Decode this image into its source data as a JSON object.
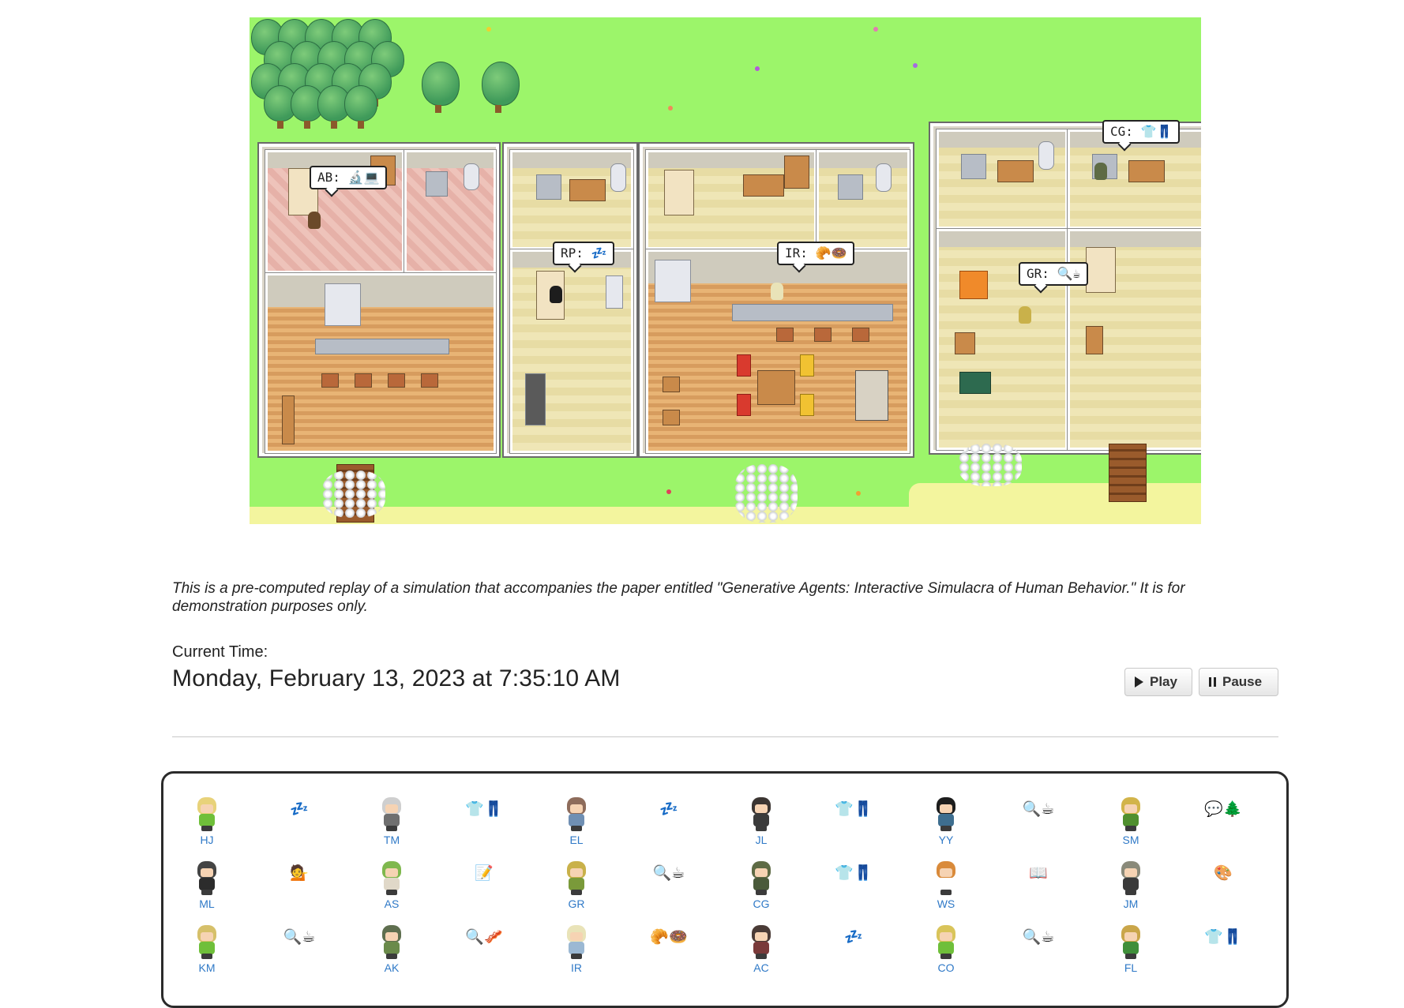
{
  "map": {
    "bubbles": [
      {
        "id": "AB",
        "text": "AB: 🔬💻"
      },
      {
        "id": "RP",
        "text": "RP: 💤"
      },
      {
        "id": "IR",
        "text": "IR: 🥐🍩"
      },
      {
        "id": "CG",
        "text": "CG: 👕👖"
      },
      {
        "id": "GR",
        "text": "GR: 🔍☕"
      }
    ]
  },
  "caption": "This is a pre-computed replay of a simulation that accompanies the paper entitled \"Generative Agents: Interactive Simulacra of Human Behavior.\" It is for demonstration purposes only.",
  "time": {
    "label": "Current Time:",
    "value": "Monday, February 13, 2023 at 7:35:10 AM"
  },
  "controls": {
    "play_label": "Play",
    "pause_label": "Pause"
  },
  "agents": {
    "rows": [
      [
        {
          "initials": "HJ",
          "hair": "#e8d27a",
          "shirt": "#6fbf3a",
          "emoji": "💤"
        },
        {
          "initials": "TM",
          "hair": "#cfcfcf",
          "shirt": "#6f6f6f",
          "emoji": "👕👖"
        },
        {
          "initials": "EL",
          "hair": "#8e6c5b",
          "shirt": "#6f8fb3",
          "emoji": "💤"
        },
        {
          "initials": "JL",
          "hair": "#3b3532",
          "shirt": "#3b3b3b",
          "emoji": "👕👖"
        },
        {
          "initials": "YY",
          "hair": "#1d1d1d",
          "shirt": "#3e6e8f",
          "emoji": "🔍☕"
        },
        {
          "initials": "SM",
          "hair": "#d2b44a",
          "shirt": "#4f8f2e",
          "emoji": "💬🌲"
        }
      ],
      [
        {
          "initials": "ML",
          "hair": "#444444",
          "shirt": "#2c2c2c",
          "emoji": "💁"
        },
        {
          "initials": "AS",
          "hair": "#7fb84e",
          "shirt": "#e0d8c8",
          "emoji": "📝"
        },
        {
          "initials": "GR",
          "hair": "#c9b14a",
          "shirt": "#7a9a3a",
          "emoji": "🔍☕"
        },
        {
          "initials": "CG",
          "hair": "#5e6b45",
          "shirt": "#4a5a3a",
          "emoji": "👕👖"
        },
        {
          "initials": "WS",
          "hair": "#d98a3a",
          "shirt": "#ffffff",
          "emoji": "📖"
        },
        {
          "initials": "JM",
          "hair": "#8a8a7a",
          "shirt": "#3a3a3a",
          "emoji": "🎨"
        }
      ],
      [
        {
          "initials": "KM",
          "hair": "#d6c06a",
          "shirt": "#6fbf3a",
          "emoji": "🔍☕"
        },
        {
          "initials": "AK",
          "hair": "#5f6f4f",
          "shirt": "#6a8a4a",
          "emoji": "🔍🥓"
        },
        {
          "initials": "IR",
          "hair": "#e9e3b8",
          "shirt": "#9bb8d3",
          "emoji": "🥐🍩"
        },
        {
          "initials": "AC",
          "hair": "#4a3b36",
          "shirt": "#7a3a3a",
          "emoji": "💤"
        },
        {
          "initials": "CO",
          "hair": "#d9c45a",
          "shirt": "#6fbf3a",
          "emoji": "🔍☕"
        },
        {
          "initials": "FL",
          "hair": "#caa64a",
          "shirt": "#3f8f3a",
          "emoji": "👕👖"
        }
      ]
    ]
  }
}
